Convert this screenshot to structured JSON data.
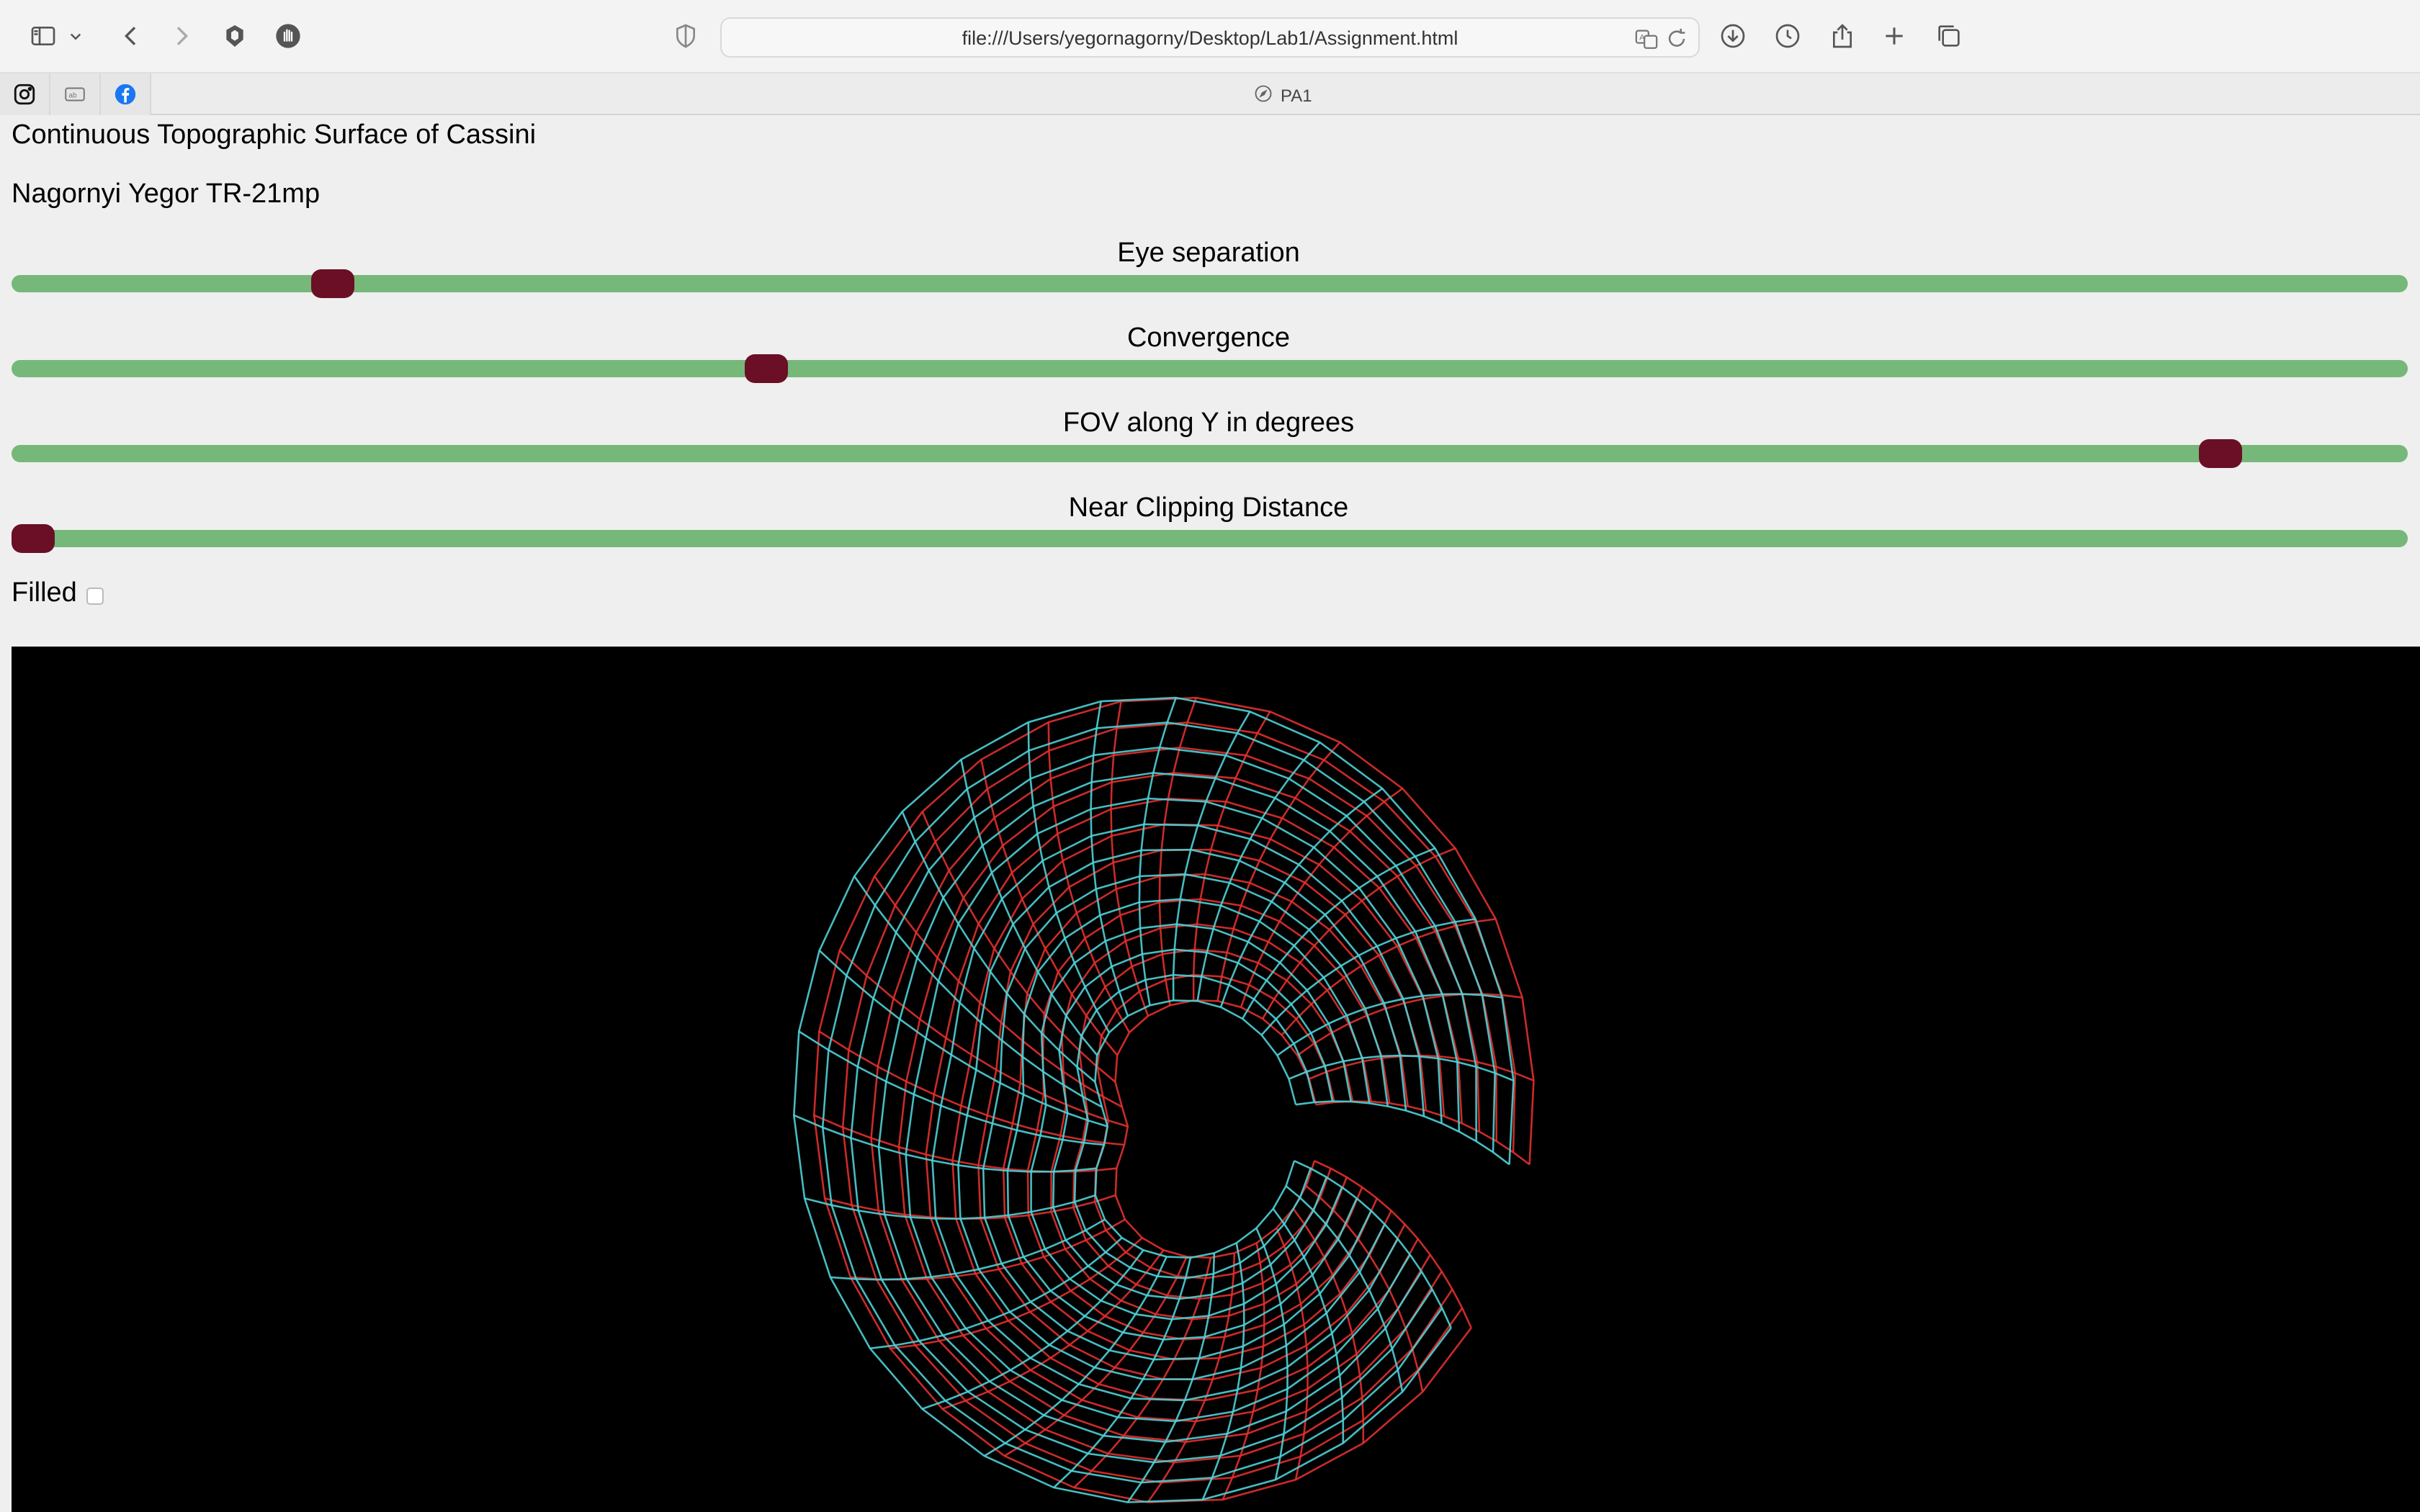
{
  "browser": {
    "url": "file:///Users/yegornagorny/Desktop/Lab1/Assignment.html",
    "active_tab_title": "PA1",
    "pinned_tabs": [
      "instagram-icon",
      "translate-icon",
      "facebook-icon"
    ],
    "toolbar_icons": [
      "sidebar-icon",
      "chevron-down-icon",
      "back-icon",
      "forward-icon",
      "extension-icon",
      "hand-icon",
      "shield-icon",
      "translate-icon",
      "reload-icon",
      "download-icon",
      "history-icon",
      "share-icon",
      "new-tab-icon",
      "tab-overview-icon"
    ]
  },
  "page": {
    "title": "Continuous Topographic Surface of Cassini",
    "author": "Nagornyi Yegor TR-21mp",
    "sliders": [
      {
        "label": "Eye separation",
        "value_fraction": 0.134
      },
      {
        "label": "Convergence",
        "value_fraction": 0.315
      },
      {
        "label": "FOV along Y in degrees",
        "value_fraction": 0.922
      },
      {
        "label": "Near Clipping Distance",
        "value_fraction": 0.0
      }
    ],
    "filled": {
      "label": "Filled",
      "checked": false
    }
  },
  "colors": {
    "track": "#76b879",
    "thumb": "#6a0f25",
    "anaglyph_left": "#e0302c",
    "anaglyph_right": "#4fd0d6",
    "canvas_bg": "#000000"
  }
}
